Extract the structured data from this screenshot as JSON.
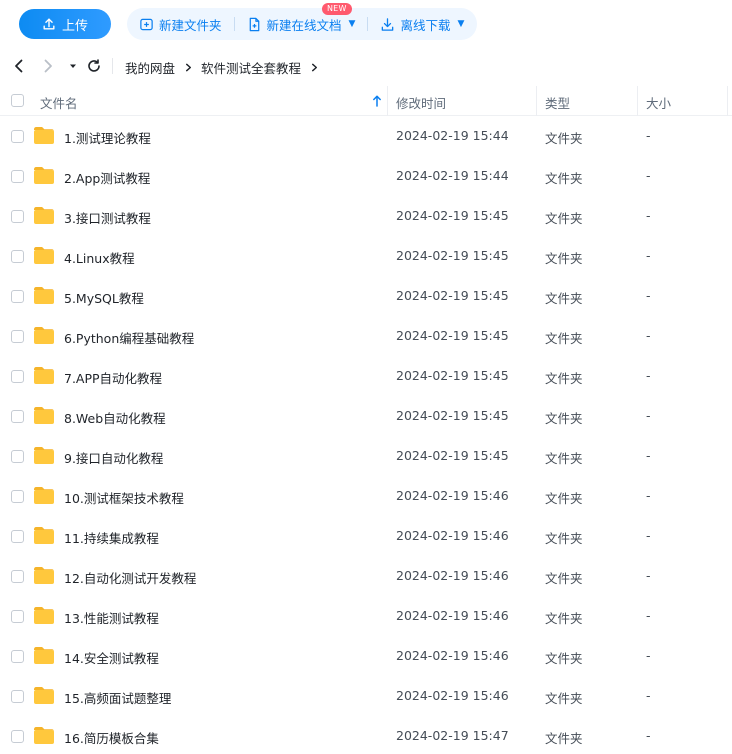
{
  "toolbar": {
    "upload_label": "上传",
    "new_folder_label": "新建文件夹",
    "new_online_doc_label": "新建在线文档",
    "new_badge": "NEW",
    "offline_download_label": "离线下载"
  },
  "nav": {
    "breadcrumb": [
      "我的网盘",
      "软件测试全套教程"
    ]
  },
  "table": {
    "columns": {
      "name": "文件名",
      "modified": "修改时间",
      "type": "类型",
      "size": "大小"
    },
    "rows": [
      {
        "name": "1.测试理论教程",
        "modified": "2024-02-19 15:44",
        "type": "文件夹",
        "size": "-"
      },
      {
        "name": "2.App测试教程",
        "modified": "2024-02-19 15:44",
        "type": "文件夹",
        "size": "-"
      },
      {
        "name": "3.接口测试教程",
        "modified": "2024-02-19 15:45",
        "type": "文件夹",
        "size": "-"
      },
      {
        "name": "4.Linux教程",
        "modified": "2024-02-19 15:45",
        "type": "文件夹",
        "size": "-"
      },
      {
        "name": "5.MySQL教程",
        "modified": "2024-02-19 15:45",
        "type": "文件夹",
        "size": "-"
      },
      {
        "name": "6.Python编程基础教程",
        "modified": "2024-02-19 15:45",
        "type": "文件夹",
        "size": "-"
      },
      {
        "name": "7.APP自动化教程",
        "modified": "2024-02-19 15:45",
        "type": "文件夹",
        "size": "-"
      },
      {
        "name": "8.Web自动化教程",
        "modified": "2024-02-19 15:45",
        "type": "文件夹",
        "size": "-"
      },
      {
        "name": "9.接口自动化教程",
        "modified": "2024-02-19 15:45",
        "type": "文件夹",
        "size": "-"
      },
      {
        "name": "10.测试框架技术教程",
        "modified": "2024-02-19 15:46",
        "type": "文件夹",
        "size": "-"
      },
      {
        "name": "11.持续集成教程",
        "modified": "2024-02-19 15:46",
        "type": "文件夹",
        "size": "-"
      },
      {
        "name": "12.自动化测试开发教程",
        "modified": "2024-02-19 15:46",
        "type": "文件夹",
        "size": "-"
      },
      {
        "name": "13.性能测试教程",
        "modified": "2024-02-19 15:46",
        "type": "文件夹",
        "size": "-"
      },
      {
        "name": "14.安全测试教程",
        "modified": "2024-02-19 15:46",
        "type": "文件夹",
        "size": "-"
      },
      {
        "name": "15.高频面试题整理",
        "modified": "2024-02-19 15:46",
        "type": "文件夹",
        "size": "-"
      },
      {
        "name": "16.简历模板合集",
        "modified": "2024-02-19 15:47",
        "type": "文件夹",
        "size": "-"
      }
    ]
  },
  "colors": {
    "accent": "#0a7ff0",
    "folder": "#ffc83d",
    "badge": "#ff5a6e"
  },
  "icons": {
    "upload": "upload-icon",
    "new_folder": "folder-plus-icon",
    "new_doc": "document-icon",
    "download": "download-icon",
    "back": "chevron-left-icon",
    "forward": "chevron-right-icon",
    "history": "caret-down-icon",
    "refresh": "refresh-icon",
    "sort": "arrow-up-icon",
    "folder": "folder-icon"
  }
}
